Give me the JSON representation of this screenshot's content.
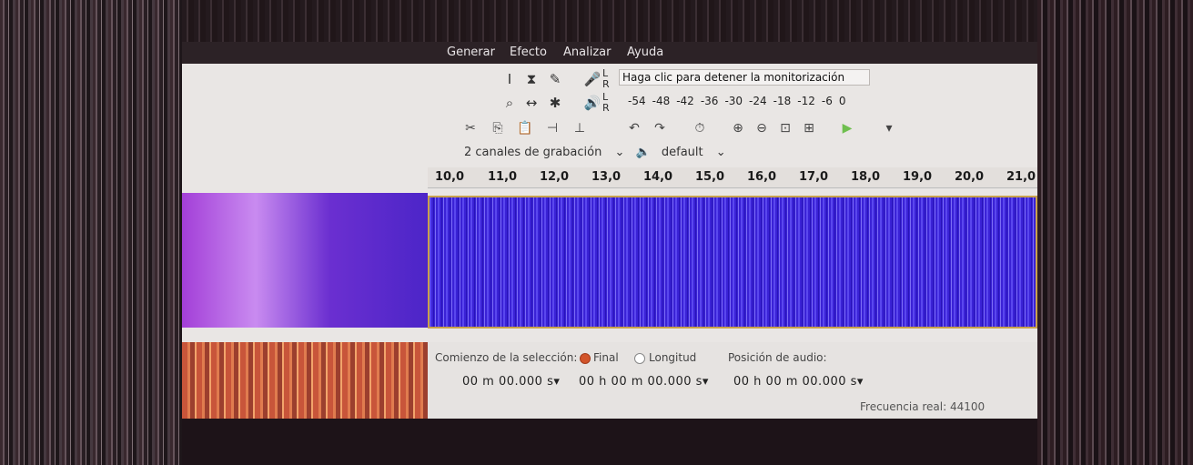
{
  "menu": [
    "Generar",
    "Efecto",
    "Analizar",
    "Ayuda"
  ],
  "meter": {
    "monitor_label": "Haga clic para detener la monitorización",
    "ticks": [
      "-54",
      "-48",
      "-42",
      "-36",
      "-30",
      "-24",
      "-18",
      "-12",
      "-6",
      "0"
    ],
    "channel_l": "L",
    "channel_r": "R"
  },
  "device": {
    "channels": "2 canales de grabación",
    "output": "default"
  },
  "ruler": [
    "10,0",
    "11,0",
    "12,0",
    "13,0",
    "14,0",
    "15,0",
    "16,0",
    "17,0",
    "18,0",
    "19,0",
    "20,0",
    "21,0"
  ],
  "selection": {
    "start_label": "Comienzo de la selección:",
    "end_label": "Final",
    "length_label": "Longitud",
    "position_label": "Posición de audio:",
    "start_time": "00 m 00.000 s",
    "end_time": "00 h 00 m 00.000 s",
    "position_time": "00 h 00 m 00.000 s",
    "selected_mode": "Final"
  },
  "status": {
    "rate": "Frecuencia real: 44100"
  },
  "colors": {
    "waveform": "#3a22d6",
    "waveform_border": "#c8a14c",
    "selected_radio": "#d2542a"
  },
  "icons": [
    "selection-tool-icon",
    "envelope-tool-icon",
    "draw-tool-icon",
    "record-meter-icon",
    "zoom-tool-icon",
    "timeshift-tool-icon",
    "multi-tool-icon",
    "playback-meter-icon"
  ]
}
